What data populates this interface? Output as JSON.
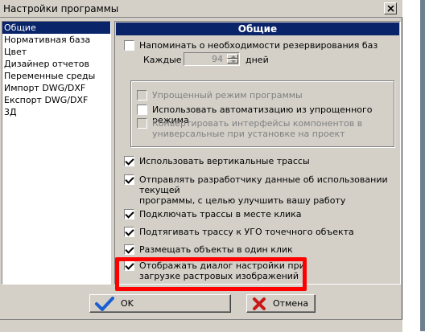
{
  "window": {
    "title": "Настройки программы"
  },
  "sidebar": {
    "items": [
      {
        "label": "Общие",
        "selected": true
      },
      {
        "label": "Нормативная база",
        "selected": false
      },
      {
        "label": "Цвет",
        "selected": false
      },
      {
        "label": "Дизайнер отчетов",
        "selected": false
      },
      {
        "label": "Переменные среды",
        "selected": false
      },
      {
        "label": "Импорт DWG/DXF",
        "selected": false
      },
      {
        "label": "Експорт DWG/DXF",
        "selected": false
      },
      {
        "label": "3Д",
        "selected": false
      }
    ]
  },
  "content": {
    "header": "Общие",
    "remind_backup": {
      "label": "Напоминать о необходимости резервирования баз",
      "checked": false
    },
    "every_label": "Каждые",
    "every_value": "94",
    "days_label": "дней",
    "simple_mode": {
      "label": "Упрощенный режим программы",
      "checked": false,
      "enabled": false
    },
    "use_automation": {
      "label": "Использовать автоматизацию из упрощенного режима",
      "checked": false,
      "enabled": true
    },
    "convert_interfaces": {
      "line1": "Конвертировать интерфейсы компонентов в",
      "line2": "универсальные при установке на проект",
      "checked": false,
      "enabled": false
    },
    "vertical_routes": {
      "label": "Использовать вертикальные трассы",
      "checked": true
    },
    "send_usage": {
      "line1": "Отправлять разработчику данные об использовании текущей",
      "line2": "программы, с целью улучшить вашу работу",
      "checked": true
    },
    "connect_routes": {
      "label": "Подключать трассы в месте клика",
      "checked": true
    },
    "pull_route": {
      "label": "Подтягивать трассу к УГО точечного объекта",
      "checked": true
    },
    "place_objects": {
      "label": "Размещать объекты в один клик",
      "checked": true
    },
    "show_raster_dialog": {
      "line1": "Отображать диалог настройки при",
      "line2": "загрузке растровых изображений",
      "checked": true
    }
  },
  "buttons": {
    "ok": "OK",
    "cancel": "Отмена"
  },
  "colors": {
    "selection": "#0a246a",
    "highlight": "#ff0000",
    "face": "#d4d0c8"
  }
}
